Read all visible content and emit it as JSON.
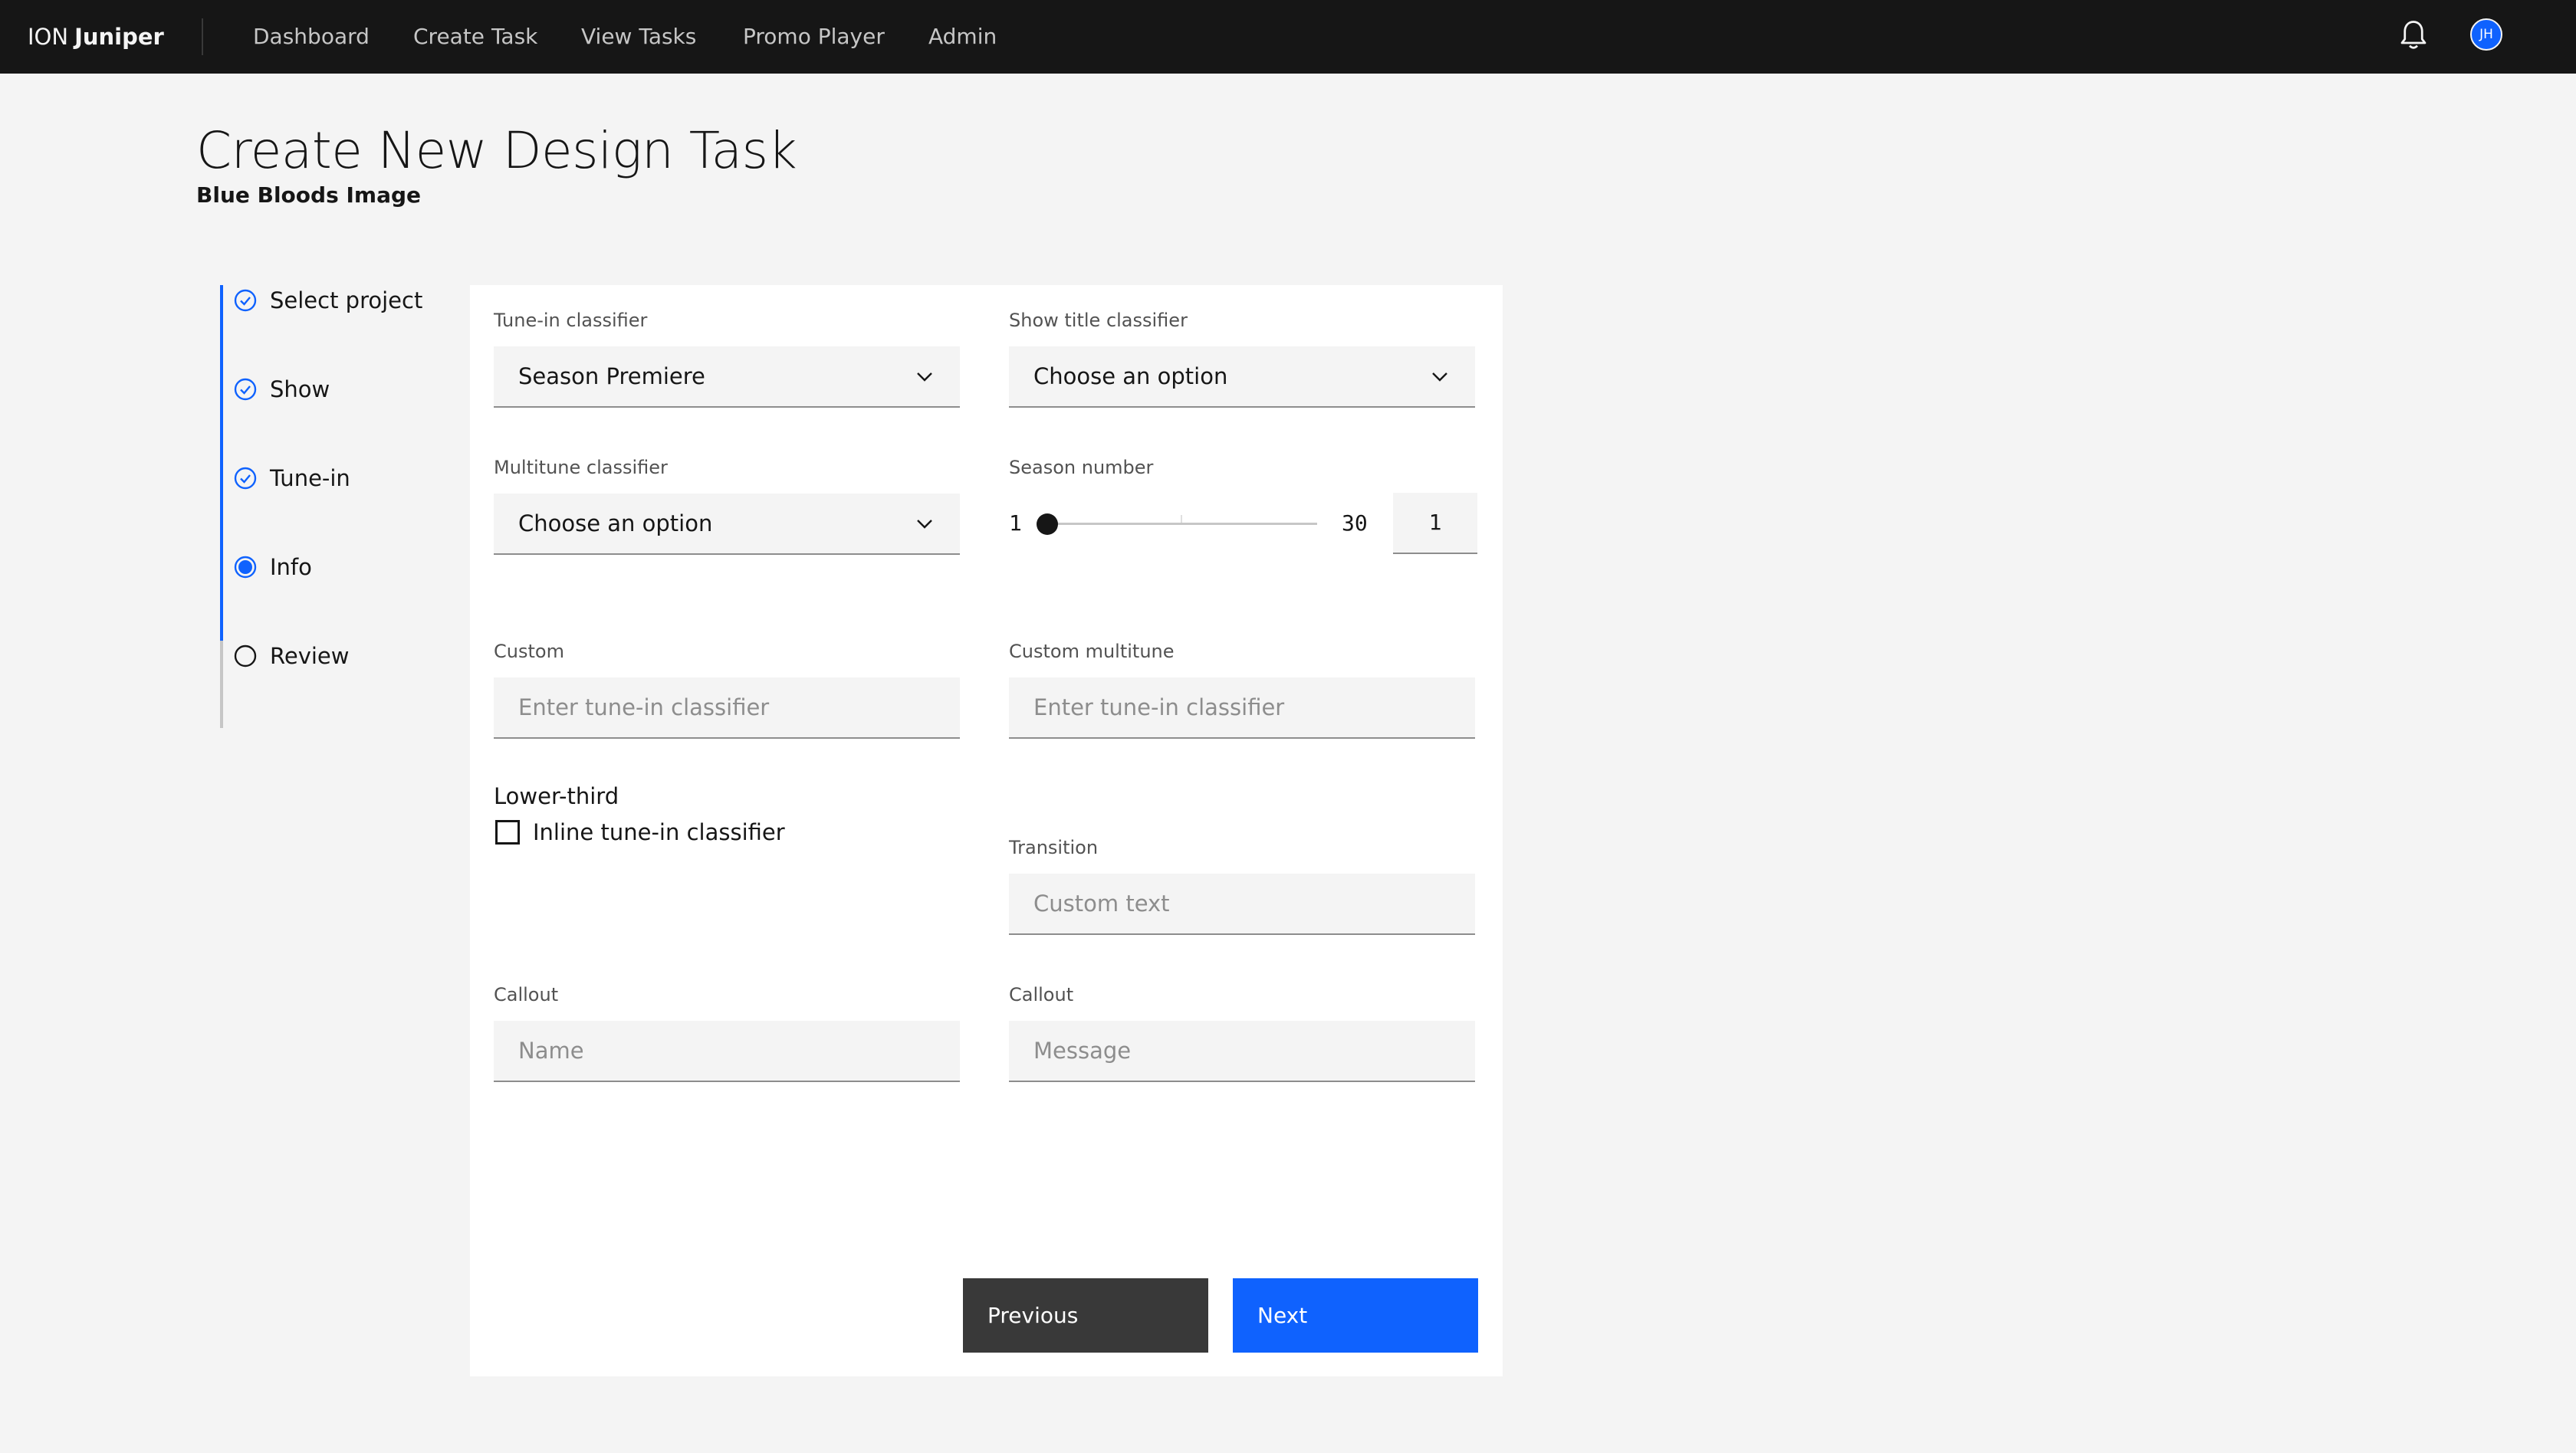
{
  "app": {
    "brand_prefix": "ION",
    "brand_name": "Juniper",
    "avatar_initials": "JH"
  },
  "nav": {
    "items": [
      "Dashboard",
      "Create Task",
      "View Tasks",
      "Promo Player",
      "Admin"
    ]
  },
  "page": {
    "title": "Create New Design Task",
    "subtitle": "Blue Bloods Image"
  },
  "steps": [
    {
      "label": "Select project",
      "state": "complete"
    },
    {
      "label": "Show",
      "state": "complete"
    },
    {
      "label": "Tune-in",
      "state": "complete"
    },
    {
      "label": "Info",
      "state": "current"
    },
    {
      "label": "Review",
      "state": "incomplete"
    }
  ],
  "form": {
    "tunein_classifier": {
      "label": "Tune-in classifier",
      "value": "Season Premiere"
    },
    "show_title_classifier": {
      "label": "Show title classifier",
      "value": "Choose an option"
    },
    "multitune_classifier": {
      "label": "Multitune classifier",
      "value": "Choose an option"
    },
    "season_number": {
      "label": "Season number",
      "min": "1",
      "max": "30",
      "value": "1"
    },
    "custom": {
      "label": "Custom",
      "placeholder": "Enter tune-in classifier"
    },
    "custom_multitune": {
      "label": "Custom multitune",
      "placeholder": "Enter tune-in classifier"
    },
    "lower_third": {
      "label": "Lower-third",
      "checkbox_label": "Inline tune-in classifier",
      "checked": false
    },
    "transition": {
      "label": "Transition",
      "placeholder": "Custom text"
    },
    "callout_name": {
      "label": "Callout",
      "placeholder": "Name"
    },
    "callout_message": {
      "label": "Callout",
      "placeholder": "Message"
    }
  },
  "buttons": {
    "previous": "Previous",
    "next": "Next"
  },
  "colors": {
    "header_bg": "#161616",
    "accent": "#0f62fe",
    "page_bg": "#f4f4f4",
    "secondary_button": "#393939"
  },
  "icons": {
    "notification": "bell-icon",
    "step_complete": "checkmark-outline-icon",
    "step_current": "current-step-icon",
    "step_incomplete": "circle-outline-icon",
    "dropdown": "chevron-down-icon"
  }
}
